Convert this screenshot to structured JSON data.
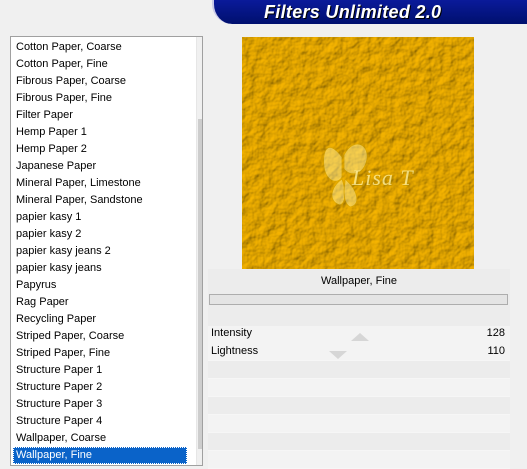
{
  "header": {
    "title": "Filters Unlimited 2.0"
  },
  "filter_list": {
    "items": [
      "Cotton Paper, Coarse",
      "Cotton Paper, Fine",
      "Fibrous Paper, Coarse",
      "Fibrous Paper, Fine",
      "Filter Paper",
      "Hemp Paper 1",
      "Hemp Paper 2",
      "Japanese Paper",
      "Mineral Paper, Limestone",
      "Mineral Paper, Sandstone",
      "papier kasy 1",
      "papier kasy 2",
      "papier kasy jeans 2",
      "papier kasy jeans",
      "Papyrus",
      "Rag Paper",
      "Recycling Paper",
      "Striped Paper, Coarse",
      "Striped Paper, Fine",
      "Structure Paper 1",
      "Structure Paper 2",
      "Structure Paper 3",
      "Structure Paper 4",
      "Wallpaper, Coarse",
      "Wallpaper, Fine"
    ],
    "selected": "Wallpaper, Fine"
  },
  "preview": {
    "watermark": "Lisa T",
    "color": "#f1c400"
  },
  "panel": {
    "filter_name": "Wallpaper, Fine",
    "params": [
      {
        "label": "Intensity",
        "value": "128"
      },
      {
        "label": "Lightness",
        "value": "110"
      }
    ]
  },
  "colors": {
    "banner": "#0a1a9a",
    "selection": "#0a63c9",
    "preview_yellow": "#f1c400"
  }
}
